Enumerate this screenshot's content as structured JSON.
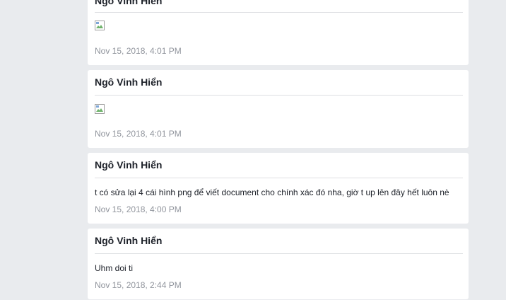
{
  "posts": [
    {
      "author": "Ngô Vinh Hiển",
      "content_type": "image",
      "timestamp": "Nov 15, 2018, 4:01 PM"
    },
    {
      "author": "Ngô Vinh Hiển",
      "content_type": "image",
      "timestamp": "Nov 15, 2018, 4:01 PM"
    },
    {
      "author": "Ngô Vinh Hiển",
      "content_type": "text",
      "text": "t có sửa lại 4 cái hình png để viết document cho chính xác đó nha, giờ t up lên đây hết luôn nè",
      "timestamp": "Nov 15, 2018, 4:00 PM"
    },
    {
      "author": "Ngô Vinh Hiển",
      "content_type": "text",
      "text": "Uhm doi ti",
      "timestamp": "Nov 15, 2018, 2:44 PM"
    }
  ],
  "icons": {
    "broken_image": "broken-image-icon"
  },
  "colors": {
    "background": "#e9ebee",
    "card": "#ffffff",
    "author_text": "#1d2129",
    "timestamp_text": "#90949c",
    "divider": "#dddfe2"
  }
}
